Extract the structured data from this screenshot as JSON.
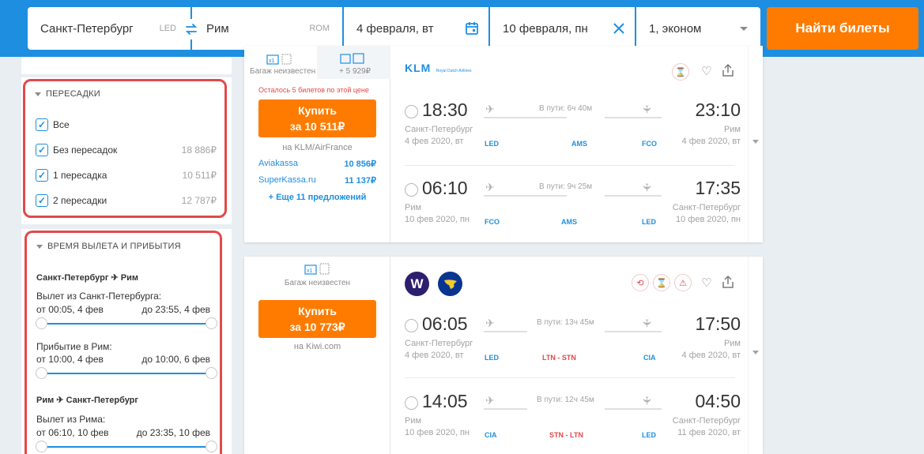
{
  "search": {
    "origin": "Санкт-Петербург",
    "origin_code": "LED",
    "destination": "Рим",
    "destination_code": "ROM",
    "depart_date": "4 февраля, вт",
    "return_date": "10 февраля, пн",
    "passengers": "1, эконом",
    "find_label": "Найти билеты"
  },
  "filters": {
    "transfers": {
      "title": "ПЕРЕСАДКИ",
      "options": [
        {
          "label": "Все",
          "price": ""
        },
        {
          "label": "Без пересадок",
          "price": "18 886₽"
        },
        {
          "label": "1 пересадка",
          "price": "10 511₽"
        },
        {
          "label": "2 пересадки",
          "price": "12 787₽"
        }
      ]
    },
    "times": {
      "title": "ВРЕМЯ ВЫЛЕТА И ПРИБЫТИЯ",
      "route1": "Санкт-Петербург ✈ Рим",
      "dep1_label": "Вылет из Санкт-Петербурга:",
      "dep1_from": "от 00:05, 4 фев",
      "dep1_to": "до 23:55, 4 фев",
      "arr1_label": "Прибытие в Рим:",
      "arr1_from": "от 10:00, 4 фев",
      "arr1_to": "до 10:00, 6 фев",
      "route2": "Рим ✈ Санкт-Петербург",
      "dep2_label": "Вылет из Рима:",
      "dep2_from": "от 06:10, 10 фев",
      "dep2_to": "до 23:35, 10 фев"
    }
  },
  "tickets": [
    {
      "baggage_left": "Багаж неизвестен",
      "baggage_left_icons": "x1",
      "baggage_right_icons": "12 23",
      "baggage_right_price": "+ 5 929₽",
      "remaining": "Осталось 5 билетов по этой цене",
      "buy_line1": "Купить",
      "buy_line2": "за 10 511₽",
      "seller": "на KLM/AirFrance",
      "agents": [
        {
          "name": "Aviakassa",
          "price": "10 856₽"
        },
        {
          "name": "SuperKassa.ru",
          "price": "11 137₽"
        }
      ],
      "more": "+ Еще 11 предложений",
      "airline_logo": "KLM",
      "airline_sub": "Royal Dutch Airlines",
      "segments": [
        {
          "dep_time": "18:30",
          "arr_time": "23:10",
          "duration": "В пути: 6ч 40м",
          "dep_city": "Санкт-Петербург",
          "arr_city": "Рим",
          "dep_date": "4 фев 2020, вт",
          "arr_date": "4 фев 2020, вт",
          "dep_code": "LED",
          "stop": "AMS",
          "arr_code": "FCO"
        },
        {
          "dep_time": "06:10",
          "arr_time": "17:35",
          "duration": "В пути: 9ч 25м",
          "dep_city": "Рим",
          "arr_city": "Санкт-Петербург",
          "dep_date": "10 фев 2020, пн",
          "arr_date": "10 фев 2020, пн",
          "dep_code": "FCO",
          "stop": "AMS",
          "arr_code": "LED"
        }
      ]
    },
    {
      "baggage_left": "Багаж неизвестен",
      "baggage_left_icons": "x1",
      "buy_line1": "Купить",
      "buy_line2": "за 10 773₽",
      "seller": "на Kiwi.com",
      "segments": [
        {
          "dep_time": "06:05",
          "arr_time": "17:50",
          "duration": "В пути: 13ч 45м",
          "dep_city": "Санкт-Петербург",
          "arr_city": "Рим",
          "dep_date": "4 фев 2020, вт",
          "arr_date": "4 фев 2020, вт",
          "dep_code": "LED",
          "stop": "LTN - STN",
          "arr_code": "CIA"
        },
        {
          "dep_time": "14:05",
          "arr_time": "04:50",
          "duration": "В пути: 12ч 45м",
          "dep_city": "Рим",
          "arr_city": "Санкт-Петербург",
          "dep_date": "10 фев 2020, пн",
          "arr_date": "11 фев 2020, вт",
          "dep_code": "CIA",
          "stop": "STN - LTN",
          "arr_code": "LED"
        }
      ]
    }
  ]
}
